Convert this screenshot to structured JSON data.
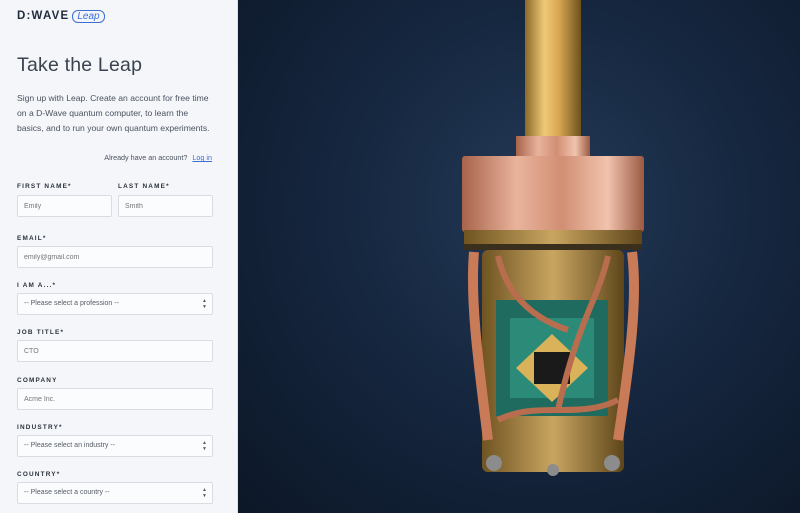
{
  "logo": {
    "brand": "D:WAVE",
    "product": "Leap"
  },
  "page_title": "Take the Leap",
  "intro_text": "Sign up with Leap. Create an account for free time on a D-Wave quantum computer, to learn the basics, and to run your own quantum experiments.",
  "login_prompt": {
    "text": "Already have an account?",
    "link": "Log in"
  },
  "form": {
    "first_name": {
      "label": "FIRST NAME*",
      "placeholder": "Emily"
    },
    "last_name": {
      "label": "LAST NAME*",
      "placeholder": "Smith"
    },
    "email": {
      "label": "EMAIL*",
      "placeholder": "emily@gmail.com"
    },
    "profession": {
      "label": "I AM A...*",
      "value": "-- Please select a profession --"
    },
    "job_title": {
      "label": "JOB TITLE*",
      "placeholder": "CTO"
    },
    "company": {
      "label": "COMPANY",
      "placeholder": "Acme Inc."
    },
    "industry": {
      "label": "INDUSTRY*",
      "value": "-- Please select an industry --"
    },
    "country": {
      "label": "COUNTRY*",
      "value": "-- Please select a country --"
    }
  },
  "hero_image": {
    "description_icon": "quantum-processor-image"
  },
  "colors": {
    "accent": "#3b6fd6",
    "panel_bg": "#f4f6f9",
    "hero_bg": "#162740"
  }
}
